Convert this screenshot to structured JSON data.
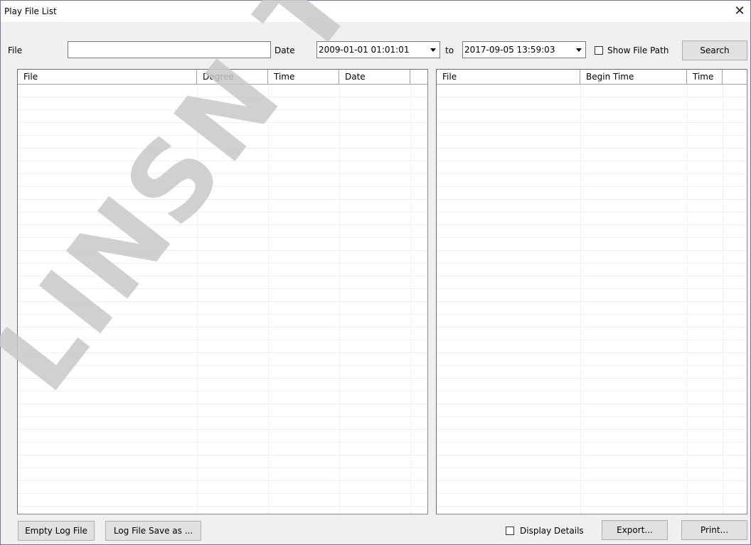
{
  "window": {
    "title": "Play File List"
  },
  "filters": {
    "file_label": "File",
    "file_value": "",
    "date_label": "Date",
    "date_from": "2009-01-01 01:01:01",
    "to_label": "to",
    "date_to": "2017-09-05 13:59:03",
    "show_path_label": "Show File Path",
    "show_path_checked": false,
    "search_label": "Search"
  },
  "left_list": {
    "columns": [
      "File",
      "Degree",
      "Time",
      "Date",
      ""
    ],
    "rows": []
  },
  "right_list": {
    "columns": [
      "File",
      "Begin Time",
      "Time",
      ""
    ],
    "rows": []
  },
  "footer": {
    "empty_log_label": "Empty Log File",
    "save_as_label": "Log File Save as ...",
    "display_details_label": "Display Details",
    "display_details_checked": false,
    "export_label": "Export...",
    "print_label": "Print..."
  },
  "watermark": {
    "text": "LINSN TEC"
  },
  "colors": {
    "window_bg": "#f0f0f0",
    "border": "#7a6fa8",
    "watermark": "#c8c8c8"
  }
}
